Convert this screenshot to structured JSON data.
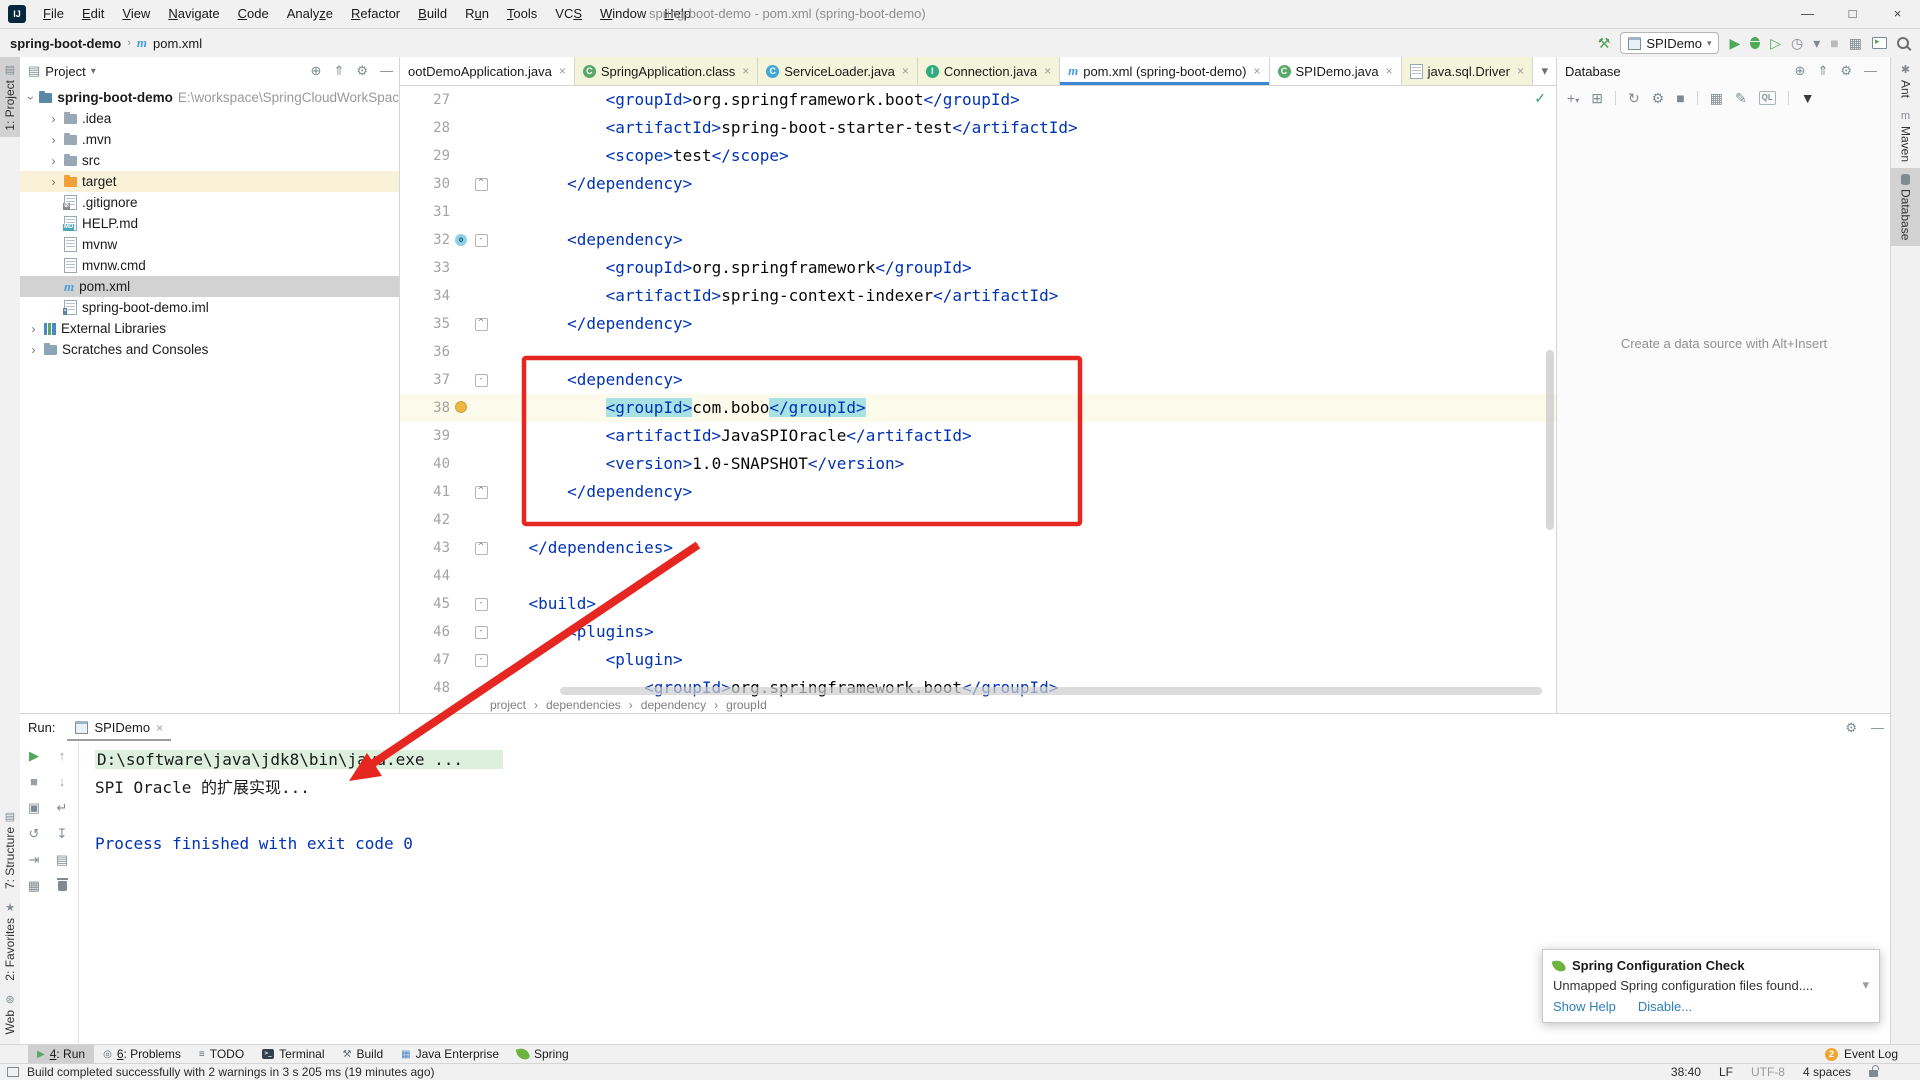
{
  "window": {
    "title": "spring-boot-demo - pom.xml (spring-boot-demo)",
    "menus": [
      {
        "label": "File",
        "u": 0
      },
      {
        "label": "Edit",
        "u": 0
      },
      {
        "label": "View",
        "u": 0
      },
      {
        "label": "Navigate",
        "u": 0
      },
      {
        "label": "Code",
        "u": 0
      },
      {
        "label": "Analyze",
        "u": 5
      },
      {
        "label": "Refactor",
        "u": 0
      },
      {
        "label": "Build",
        "u": 0
      },
      {
        "label": "Run",
        "u": 1
      },
      {
        "label": "Tools",
        "u": 0
      },
      {
        "label": "VCS",
        "u": 2
      },
      {
        "label": "Window",
        "u": 0
      },
      {
        "label": "Help",
        "u": 0
      }
    ],
    "controls": [
      {
        "name": "minimize-button",
        "glyph": "—"
      },
      {
        "name": "maximize-button",
        "glyph": "□"
      },
      {
        "name": "close-button",
        "glyph": "×"
      }
    ]
  },
  "navbar": {
    "breadcrumb": [
      "spring-boot-demo",
      "pom.xml"
    ],
    "separator": "›",
    "run_config": "SPIDemo",
    "buttons": [
      {
        "name": "build-project-button",
        "glyph": "⚒",
        "color": "#4d9e53"
      },
      {
        "name": "run-button",
        "glyph": "▶",
        "color": "#4fa956"
      },
      {
        "name": "debug-button",
        "glyph": "",
        "cls": "ico-bug"
      },
      {
        "name": "coverage-button",
        "glyph": "▷",
        "color": "#4fa956"
      },
      {
        "name": "profiler-button",
        "glyph": "◷",
        "color": "#7f8b91"
      },
      {
        "name": "profiler-dropdown",
        "glyph": "▾",
        "color": "#7f8b91"
      },
      {
        "name": "stop-button",
        "glyph": "■",
        "color": "#b9b9b9"
      },
      {
        "name": "layout-button",
        "glyph": "▦",
        "color": "#7f8b91"
      },
      {
        "name": "run-anything-button",
        "glyph": "",
        "cls": "ico-winplay"
      },
      {
        "name": "search-everywhere-button",
        "glyph": "",
        "cls": "ico-search"
      }
    ]
  },
  "left_strip": {
    "top": [
      {
        "label": "1: Project",
        "icon": "▤",
        "active": true
      }
    ],
    "bottom": [
      {
        "label": "7: Structure",
        "icon": "▤"
      },
      {
        "label": "2: Favorites",
        "icon": "★"
      },
      {
        "label": "Web",
        "icon": "⊛"
      }
    ]
  },
  "right_strip": [
    {
      "label": "Ant",
      "icon": "✱"
    },
    {
      "label": "Maven",
      "icon": "m"
    },
    {
      "label": "Database",
      "icon": "db",
      "active": true
    }
  ],
  "project_panel": {
    "header": "Project",
    "header_chevron": "▾",
    "header_icons": [
      {
        "name": "locate-button",
        "glyph": "⊕"
      },
      {
        "name": "collapse-all-button",
        "glyph": "⇑"
      },
      {
        "name": "settings-button",
        "glyph": "⚙"
      },
      {
        "name": "hide-button",
        "glyph": "—"
      }
    ],
    "tree": [
      {
        "label": "spring-boot-demo",
        "sub": " E:\\workspace\\SpringCloudWorkSpac",
        "indent": 0,
        "chevron": "expanded",
        "icon": "project-root",
        "bold": true
      },
      {
        "label": ".idea",
        "indent": 1,
        "chevron": "collapsed",
        "icon": "folder"
      },
      {
        "label": ".mvn",
        "indent": 1,
        "chevron": "collapsed",
        "icon": "folder"
      },
      {
        "label": "src",
        "indent": 1,
        "chevron": "collapsed",
        "icon": "folder"
      },
      {
        "label": "target",
        "indent": 1,
        "chevron": "collapsed",
        "icon": "folder-excluded",
        "row": "highlight"
      },
      {
        "label": ".gitignore",
        "indent": 1,
        "icon": "file-ignored"
      },
      {
        "label": "HELP.md",
        "indent": 1,
        "icon": "file-md"
      },
      {
        "label": "mvnw",
        "indent": 1,
        "icon": "file-text"
      },
      {
        "label": "mvnw.cmd",
        "indent": 1,
        "icon": "file-text"
      },
      {
        "label": "pom.xml",
        "indent": 1,
        "icon": "maven",
        "row": "selected"
      },
      {
        "label": "spring-boot-demo.iml",
        "indent": 1,
        "icon": "file-iml"
      },
      {
        "label": "External Libraries",
        "indent": 0,
        "chevron": "collapsed",
        "icon": "libraries"
      },
      {
        "label": "Scratches and Consoles",
        "indent": 0,
        "chevron": "collapsed",
        "icon": "scratches"
      }
    ]
  },
  "editor": {
    "tabs": [
      {
        "label": "ootDemoApplication.java",
        "icon": "none",
        "close": true
      },
      {
        "label": "SpringApplication.class",
        "icon": "class-green",
        "lib": true,
        "close": true
      },
      {
        "label": "ServiceLoader.java",
        "icon": "class-blue",
        "lib": true,
        "close": true
      },
      {
        "label": "Connection.java",
        "icon": "interface-green",
        "lib": true,
        "close": true
      },
      {
        "label": "pom.xml (spring-boot-demo)",
        "icon": "maven",
        "selected": true,
        "close": true
      },
      {
        "label": "SPIDemo.java",
        "icon": "class-green",
        "close": true
      },
      {
        "label": "java.sql.Driver",
        "icon": "file-gray",
        "lib": true,
        "close": true
      }
    ],
    "tabs_overflow_chevron": "▾",
    "inspection_ok": "✓",
    "lines": [
      {
        "num": 27,
        "tokens": [
          [
            "            ",
            ""
          ],
          [
            "<groupId>",
            "tag"
          ],
          [
            "org.springframework.boot",
            "text"
          ],
          [
            "</groupId>",
            "tag"
          ]
        ]
      },
      {
        "num": 28,
        "tokens": [
          [
            "            ",
            ""
          ],
          [
            "<artifactId>",
            "tag"
          ],
          [
            "spring-boot-starter-test",
            "text"
          ],
          [
            "</artifactId>",
            "tag"
          ]
        ]
      },
      {
        "num": 29,
        "tokens": [
          [
            "            ",
            ""
          ],
          [
            "<scope>",
            "tag"
          ],
          [
            "test",
            "text"
          ],
          [
            "</scope>",
            "tag"
          ]
        ]
      },
      {
        "num": 30,
        "fold": "end",
        "tokens": [
          [
            "        ",
            ""
          ],
          [
            "</dependency>",
            "tag"
          ]
        ]
      },
      {
        "num": 31,
        "tokens": []
      },
      {
        "num": 32,
        "fold": "start",
        "marker": "change",
        "tokens": [
          [
            "        ",
            ""
          ],
          [
            "<dependency>",
            "tag"
          ]
        ]
      },
      {
        "num": 33,
        "tokens": [
          [
            "            ",
            ""
          ],
          [
            "<groupId>",
            "tag"
          ],
          [
            "org.springframework",
            "text"
          ],
          [
            "</groupId>",
            "tag"
          ]
        ]
      },
      {
        "num": 34,
        "tokens": [
          [
            "            ",
            ""
          ],
          [
            "<artifactId>",
            "tag"
          ],
          [
            "spring-context-indexer",
            "text"
          ],
          [
            "</artifactId>",
            "tag"
          ]
        ]
      },
      {
        "num": 35,
        "fold": "end",
        "tokens": [
          [
            "        ",
            ""
          ],
          [
            "</dependency>",
            "tag"
          ]
        ]
      },
      {
        "num": 36,
        "tokens": []
      },
      {
        "num": 37,
        "fold": "start",
        "tokens": [
          [
            "        ",
            ""
          ],
          [
            "<dependency>",
            "tag"
          ]
        ]
      },
      {
        "num": 38,
        "current": true,
        "marker": "bulb",
        "tokens": [
          [
            "            ",
            ""
          ],
          [
            "<groupId>",
            "taghl"
          ],
          [
            "com.bobo",
            "text"
          ],
          [
            "</groupId>",
            "taghl"
          ]
        ]
      },
      {
        "num": 39,
        "tokens": [
          [
            "            ",
            ""
          ],
          [
            "<artifactId>",
            "tag"
          ],
          [
            "JavaSPIOracle",
            "text"
          ],
          [
            "</artifactId>",
            "tag"
          ]
        ]
      },
      {
        "num": 40,
        "tokens": [
          [
            "            ",
            ""
          ],
          [
            "<version>",
            "tag"
          ],
          [
            "1.0-SNAPSHOT",
            "text"
          ],
          [
            "</version>",
            "tag"
          ]
        ]
      },
      {
        "num": 41,
        "fold": "end",
        "tokens": [
          [
            "        ",
            ""
          ],
          [
            "</dependency>",
            "tag"
          ]
        ]
      },
      {
        "num": 42,
        "tokens": []
      },
      {
        "num": 43,
        "fold": "end",
        "tokens": [
          [
            "    ",
            ""
          ],
          [
            "</dependencies>",
            "tag"
          ]
        ]
      },
      {
        "num": 44,
        "tokens": []
      },
      {
        "num": 45,
        "fold": "start",
        "tokens": [
          [
            "    ",
            ""
          ],
          [
            "<build>",
            "tag"
          ]
        ]
      },
      {
        "num": 46,
        "fold": "start",
        "tokens": [
          [
            "        ",
            ""
          ],
          [
            "<plugins>",
            "tag"
          ]
        ]
      },
      {
        "num": 47,
        "fold": "start",
        "tokens": [
          [
            "            ",
            ""
          ],
          [
            "<plugin>",
            "tag"
          ]
        ]
      },
      {
        "num": 48,
        "tokens": [
          [
            "                ",
            ""
          ],
          [
            "<groupId>",
            "tag"
          ],
          [
            "org.springframework.boot",
            "text"
          ],
          [
            "</groupId>",
            "tag"
          ]
        ]
      }
    ],
    "breadcrumbs": [
      "project",
      "dependencies",
      "dependency",
      "groupId"
    ],
    "breadcrumb_separator": "›"
  },
  "database_panel": {
    "header": "Database",
    "header_icons": [
      {
        "name": "locate-button",
        "glyph": "⊕"
      },
      {
        "name": "collapse-all-button",
        "glyph": "⇑"
      },
      {
        "name": "settings-button",
        "glyph": "⚙"
      },
      {
        "name": "hide-button",
        "glyph": "—"
      }
    ],
    "toolbar": [
      {
        "name": "add-data-source-button",
        "glyph": "+",
        "extra": "▾"
      },
      {
        "name": "duplicate-button",
        "glyph": "⊞"
      },
      {
        "name": "sep"
      },
      {
        "name": "refresh-button",
        "glyph": "↻"
      },
      {
        "name": "data-source-properties-button",
        "glyph": "⚙"
      },
      {
        "name": "stop-button",
        "glyph": "■"
      },
      {
        "name": "sep"
      },
      {
        "name": "table-view-button",
        "glyph": "▦"
      },
      {
        "name": "edit-button",
        "glyph": "✎"
      },
      {
        "name": "ql-console-button",
        "glyph": "QL",
        "boxed": true
      },
      {
        "name": "sep"
      },
      {
        "name": "filter-button",
        "glyph": "▼",
        "dark": true
      }
    ],
    "empty_text": "Create a data source with Alt+Insert"
  },
  "run_panel": {
    "label": "Run:",
    "tab": "SPIDemo",
    "header_icons": [
      {
        "name": "settings-button",
        "glyph": "⚙"
      },
      {
        "name": "hide-button",
        "glyph": "—"
      }
    ],
    "toolbar": [
      {
        "name": "rerun-button",
        "glyph": "▶",
        "color": "#4fa956"
      },
      {
        "name": "up-stack-button",
        "glyph": "↑",
        "color": "#9aa0a6"
      },
      {
        "name": "stop-button",
        "glyph": "■",
        "color": "#9aa0a6"
      },
      {
        "name": "down-stack-button",
        "glyph": "↓",
        "color": "#9aa0a6"
      },
      {
        "name": "dump-threads-button",
        "glyph": "▣",
        "color": "#7f8b91"
      },
      {
        "name": "soft-wrap-button",
        "glyph": "↵",
        "color": "#7f8b91"
      },
      {
        "name": "restore-layout-button",
        "glyph": "↺",
        "color": "#7f8b91"
      },
      {
        "name": "scroll-to-end-button",
        "glyph": "↧",
        "color": "#7f8b91"
      },
      {
        "name": "exit-button",
        "glyph": "⇥",
        "color": "#7f8b91"
      },
      {
        "name": "print-button",
        "glyph": "▤",
        "color": "#7f8b91"
      },
      {
        "name": "layout-settings-button",
        "glyph": "▦",
        "color": "#7f8b91"
      },
      {
        "name": "clear-all-button",
        "glyph": "",
        "cls": "ico-trash"
      }
    ],
    "lines": [
      {
        "text": "D:\\software\\java\\jdk8\\bin\\java.exe ...",
        "style": "command"
      },
      {
        "text": "SPI Oracle 的扩展实现...",
        "style": "stdout"
      },
      {
        "text": "",
        "style": "stdout"
      },
      {
        "text": "Process finished with exit code 0",
        "style": "system"
      }
    ]
  },
  "notification": {
    "title": "Spring Configuration Check",
    "body": "Unmapped Spring configuration files found....",
    "chevron": "▾",
    "links": [
      "Show Help",
      "Disable..."
    ]
  },
  "bottom_bar": {
    "items": [
      {
        "label": "4: Run",
        "u": 0,
        "icon": "play",
        "active": true
      },
      {
        "label": "6: Problems",
        "u": 0,
        "icon": "problems"
      },
      {
        "label": "TODO",
        "icon": "todo"
      },
      {
        "label": "Terminal",
        "icon": "terminal"
      },
      {
        "label": "Build",
        "icon": "hammer"
      },
      {
        "label": "Java Enterprise",
        "icon": "javaee"
      },
      {
        "label": "Spring",
        "icon": "leaf"
      }
    ],
    "event_log": {
      "badge": "2",
      "label": "Event Log"
    }
  },
  "status_bar": {
    "message": "Build completed successfully with 2 warnings in 3 s 205 ms (19 minutes ago)",
    "right": [
      {
        "label": "38:40"
      },
      {
        "label": "LF"
      },
      {
        "label": "UTF-8",
        "muted": true
      },
      {
        "label": "4 spaces"
      }
    ]
  },
  "icons": {
    "gear": "⚙",
    "hammer": "⚒",
    "play": "▶",
    "stop": "■",
    "problems": "◎",
    "todo": "≡",
    "javaee": "▦",
    "chevron-collapsed": "›",
    "chevron-expanded": "›",
    "dropdown": "▾",
    "fold-start": "-",
    "fold-end": "^",
    "check": "✓",
    "locate": "⊕",
    "collapse": "⇑",
    "minus": "—"
  },
  "colors": {
    "accent_blue": "#3e86d6",
    "xml_tag": "#0033b3",
    "tag_highlight": "#a8e2e4",
    "current_line": "#fcfaeb",
    "annotation_red": "#e62621",
    "run_green": "#4fa956",
    "lib_tab_bg": "#f3f4d9",
    "console_cmd_bg": "#ddf0dd"
  }
}
